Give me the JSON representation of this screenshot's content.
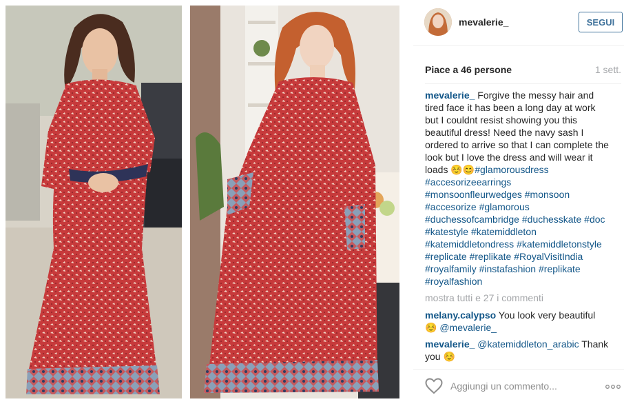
{
  "post": {
    "author": "mevalerie_",
    "follow_label": "SEGUI",
    "likes_text": "Piace a 46 persone",
    "time_ago": "1 sett.",
    "caption": {
      "author": "mevalerie_",
      "text": "Forgive the messy hair and tired face it has been a long day at work but I couldnt resist showing you this beautiful dress! Need the navy sash I ordered to arrive so that I can complete the look but I love the dress and will wear it loads ☺️😊",
      "hashtags": [
        "#glamorousdress",
        "#accesorizeearrings",
        "#monsoonfleurwedges",
        "#monsoon",
        "#accesorize",
        "#glamorous",
        "#duchessofcambridge",
        "#duchesskate",
        "#doc",
        "#katestyle",
        "#katemiddleton",
        "#katemiddletondress",
        "#katemiddletonstyle",
        "#replicate",
        "#replikate",
        "#RoyalVisitIndia",
        "#royalfamily",
        "#instafashion",
        "#replikate",
        "#royalfashion"
      ]
    },
    "show_all_comments": "mostra tutti e 27 i commenti",
    "comments": [
      {
        "author": "melany.calypso",
        "text": "You look very beautiful ☺️",
        "mention": "@mevalerie_"
      },
      {
        "author": "mevalerie_",
        "mention": "@katemiddleton_arabic",
        "text": "Thank you ☺️"
      }
    ],
    "add_comment_placeholder": "Aggiungi un commento...",
    "colors": {
      "link": "#125688",
      "follow_border": "#3f729b",
      "muted": "#a5a7aa",
      "dress_red": "#c8383a",
      "sleeve_navy": "#2e3358"
    },
    "icons": {
      "heart": "heart-outline-icon",
      "more": "more-options-icon"
    }
  }
}
